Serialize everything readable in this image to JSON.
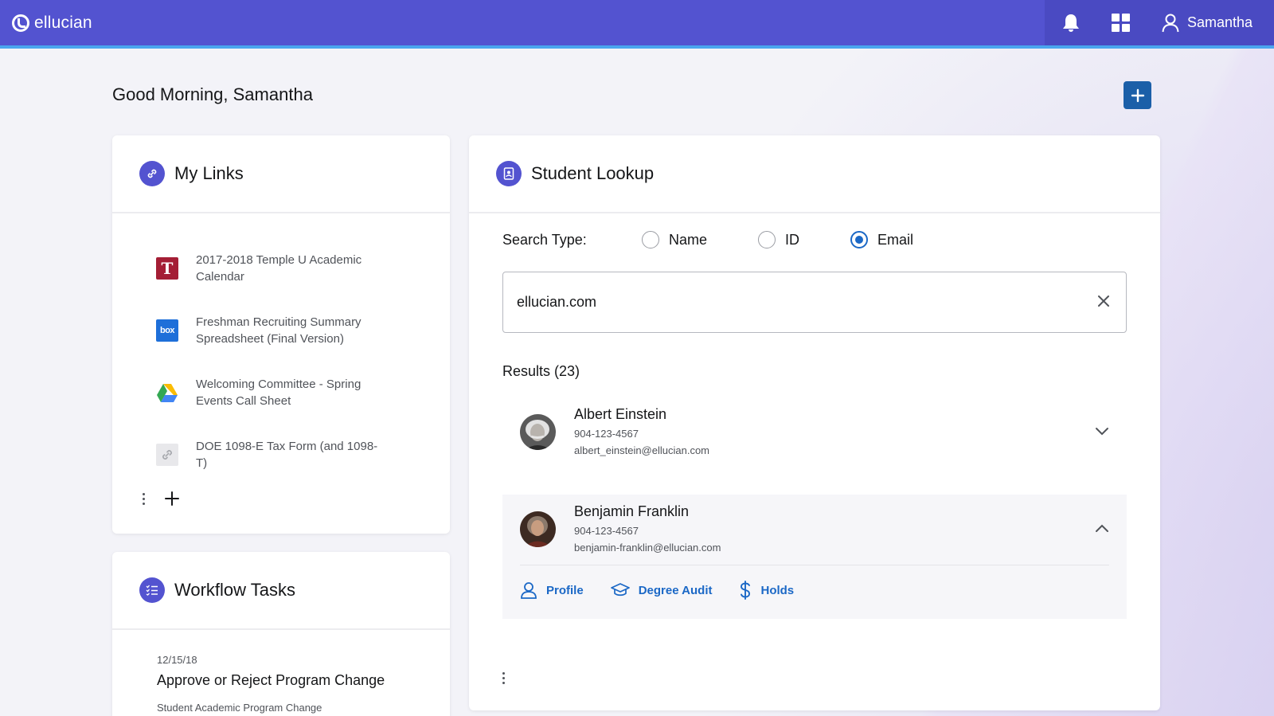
{
  "app": {
    "brand": "ellucian",
    "accent": "#5353d0",
    "header_stripe": "#4aa5ee",
    "link_blue": "#1b68c6"
  },
  "header": {
    "user_name": "Samantha",
    "icons": [
      "bell-icon",
      "apps-grid-icon",
      "user-icon"
    ]
  },
  "greeting": "Good Morning, Samantha",
  "my_links": {
    "title": "My Links",
    "items": [
      {
        "label": "2017-2018 Temple U Academic Calendar",
        "icon": "temple-u-icon",
        "icon_text": "T"
      },
      {
        "label": "Freshman Recruiting Summary Spreadsheet (Final Version)",
        "icon": "box-icon",
        "icon_text": "box"
      },
      {
        "label": "Welcoming Committee - Spring Events Call Sheet",
        "icon": "google-drive-icon"
      },
      {
        "label": "DOE 1098-E Tax Form (and 1098-T)",
        "icon": "link-icon"
      }
    ]
  },
  "workflow": {
    "title": "Workflow Tasks",
    "task": {
      "date": "12/15/18",
      "title": "Approve or Reject Program Change",
      "subtitle": "Student Academic Program Change"
    }
  },
  "lookup": {
    "title": "Student Lookup",
    "search_type_label": "Search Type:",
    "options": [
      "Name",
      "ID",
      "Email"
    ],
    "selected_option": "Email",
    "search_value": "ellucian.com",
    "results_label": "Results (23)",
    "results": [
      {
        "name": "Albert Einstein",
        "phone": "904-123-4567",
        "email": "albert_einstein@ellucian.com",
        "expanded": false
      },
      {
        "name": "Benjamin Franklin",
        "phone": "904-123-4567",
        "email": "benjamin-franklin@ellucian.com",
        "expanded": true
      }
    ],
    "actions": [
      "Profile",
      "Degree Audit",
      "Holds"
    ]
  }
}
